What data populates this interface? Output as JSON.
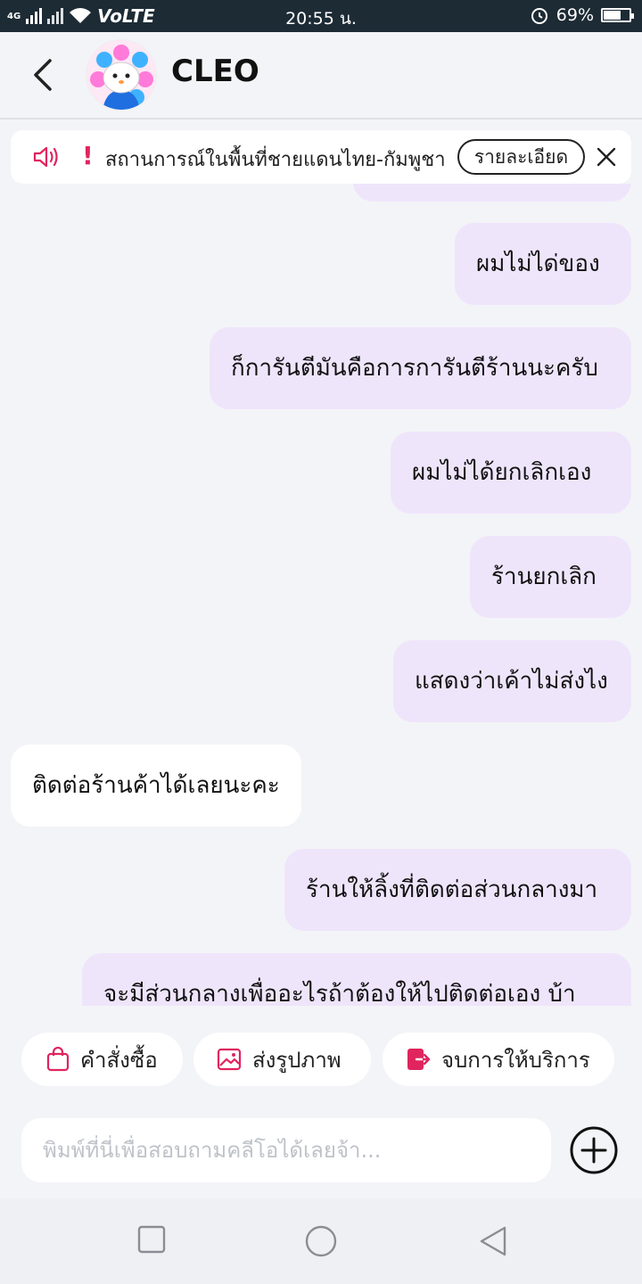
{
  "status_bar": {
    "network": "4G",
    "volte": "VoLTE",
    "time": "20:55 น.",
    "battery": "69%",
    "battery_level": 0.69
  },
  "header": {
    "title": "CLEO"
  },
  "banner": {
    "text": "สถานการณ์ในพื้นที่ชายแดนไทย-กัมพูชา",
    "detail_label": "รายละเอียด"
  },
  "messages": [
    {
      "side": "out",
      "text": "ผมไม่ได่ของ"
    },
    {
      "side": "out",
      "text": "ก็การันตีมันคือการการันตีร้านนะครับ"
    },
    {
      "side": "out",
      "text": "ผมไม่ได้ยกเลิกเอง"
    },
    {
      "side": "out",
      "text": "ร้านยกเลิก"
    },
    {
      "side": "out",
      "text": "แสดงว่าเค้าไม่ส่งไง"
    },
    {
      "side": "in",
      "text": "ติดต่อร้านค้าได้เลยนะคะ"
    },
    {
      "side": "out",
      "text": "ร้านให้ลิ้งที่ติดต่อส่วนกลางมา"
    },
    {
      "side": "out",
      "text": "จะมีส่วนกลางเพื่ออะไรถ้าต้องให้ไปติดต่อเอง บ้า"
    }
  ],
  "quick_actions": {
    "orders": "คำสั่งซื้อ",
    "send_image": "ส่งรูปภาพ",
    "end_service": "จบการให้บริการ"
  },
  "composer": {
    "placeholder": "พิมพ์ที่นี่เพื่อสอบถามคลีโอได้เลยจ้า..."
  },
  "colors": {
    "accent": "#e0245e",
    "outgoing_bubble": "#efe5fb",
    "incoming_bubble": "#ffffff",
    "status_bar": "#1d2b35"
  }
}
